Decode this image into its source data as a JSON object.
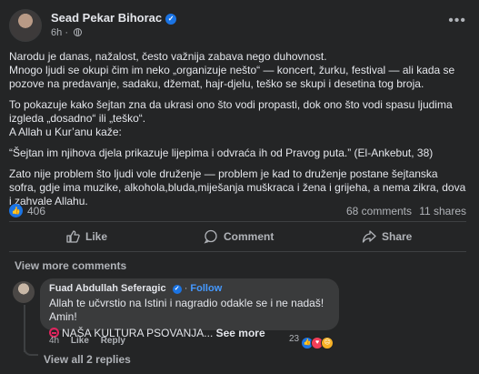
{
  "post": {
    "author": "Sead Pekar Bihorac",
    "time": "6h",
    "dot": "·",
    "paragraphs": {
      "p1a": "Narodu je danas, nažalost, često važnija zabava nego duhovnost.",
      "p1b": "Mnogo ljudi se okupi čim im neko „organizuje nešto“ — koncert, žurku, festival — ali kada se pozove na predavanje, sadaku, džemat, hajr-djelu, teško se skupi i desetina tog broja.",
      "p2": "To pokazuje kako šejtan zna da ukrasi ono što vodi propasti, dok ono što vodi spasu ljudima izgleda „dosadno“ ili „teško“.",
      "p3": "A Allah u Kur’anu kaže:",
      "p4": "“Šejtan im njihova djela prikazuje lijepima i odvraća ih od Pravog puta.” (El-Ankebut, 38)",
      "p5": "Zato nije problem što ljudi vole druženje — problem je kad to druženje postane šejtanska sofra, gdje ima muzike, alkohola,bluda,miješanja muškraca i žena i grijeha, a nema zikra, dova i zahvale Allahu."
    },
    "reaction_count": "406",
    "comments_count": "68 comments",
    "shares_count": "11 shares"
  },
  "actions": {
    "like": "Like",
    "comment": "Comment",
    "share": "Share"
  },
  "view_more_comments": "View more comments",
  "comment": {
    "author": "Fuad Abdullah Seferagic",
    "dot": "·",
    "follow": "Follow",
    "text": "Allah te učvrstio na Istini i nagradio odakle se i ne nadaš! Amin!",
    "text2": "NAŠA KULTURA PSOVANJA...",
    "see_more": "See more",
    "time": "4h",
    "like": "Like",
    "reply": "Reply",
    "reactions": "23",
    "view_replies": "View all 2 replies"
  },
  "colors": {
    "background": "#242526",
    "accent": "#1b74e4",
    "follow": "#4599ff"
  }
}
